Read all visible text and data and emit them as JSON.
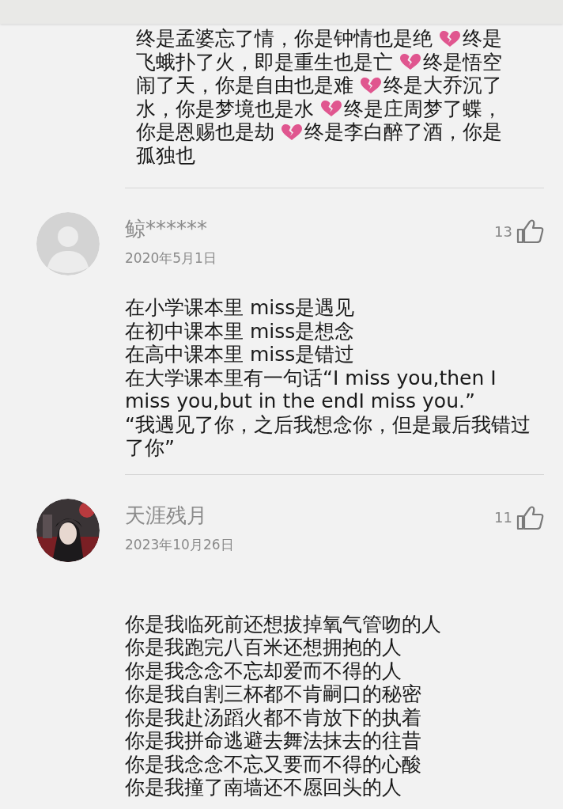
{
  "comments": [
    {
      "text_lines": [
        [
          {
            "kind": "text",
            "text": "终是孟婆忘了情，你是钟情也是绝"
          },
          {
            "kind": "heart"
          },
          {
            "kind": "text",
            "text": "终是"
          }
        ],
        [
          {
            "kind": "text",
            "text": "飞蛾扑了火，即是重生也是亡"
          },
          {
            "kind": "heart"
          },
          {
            "kind": "text",
            "text": "终是悟空"
          }
        ],
        [
          {
            "kind": "text",
            "text": "闹了天，你是自由也是难"
          },
          {
            "kind": "heart"
          },
          {
            "kind": "text",
            "text": "终是大乔沉了"
          }
        ],
        [
          {
            "kind": "text",
            "text": "水，你是梦境也是水"
          },
          {
            "kind": "heart"
          },
          {
            "kind": "text",
            "text": "终是庄周梦了蝶，"
          }
        ],
        [
          {
            "kind": "text",
            "text": "你是恩赐也是劫"
          },
          {
            "kind": "heart"
          },
          {
            "kind": "text",
            "text": "终是李白醉了酒，你是"
          }
        ],
        [
          {
            "kind": "text",
            "text": "孤独也"
          }
        ]
      ]
    },
    {
      "avatar": {
        "kind": "default"
      },
      "author": "鲸******",
      "date": "2020年5月1日",
      "likes": "13",
      "lines": [
        "在小学课本里 miss是遇见",
        "在初中课本里 miss是想念",
        "在高中课本里 miss是错过",
        "在大学课本里有一句话“I miss you,then I miss you,but in the endI miss you.”",
        "“我遇见了你，之后我想念你，但是最后我错过了你”"
      ]
    },
    {
      "author": "天涯残月",
      "date": "2023年10月26日",
      "likes": "11",
      "lines": [
        "你是我临死前还想拔掉氧气管吻的人",
        "你是我跑完八百米还想拥抱的人",
        "你是我念念不忘却爱而不得的人",
        "你是我自割三杯都不肯嗣口的秘密",
        "你是我赴汤蹈火都不肯放下的执着",
        "你是我拼命逃避去舞法抹去的往昔",
        "你是我念念不忘又要而不得的心酸",
        "你是我撞了南墙还不愿回头的人"
      ]
    }
  ]
}
